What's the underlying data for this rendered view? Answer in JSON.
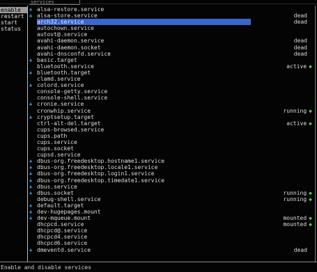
{
  "top_tab_label": "services",
  "menu": [
    {
      "label": "enable",
      "selected": true
    },
    {
      "label": "restart",
      "selected": false
    },
    {
      "label": "start",
      "selected": false
    },
    {
      "label": "status",
      "selected": false
    }
  ],
  "services": [
    {
      "name": "alsa-restore.service",
      "marker": true,
      "status": "",
      "selected": false
    },
    {
      "name": "alsa-store.service",
      "marker": true,
      "status": "dead",
      "selected": false
    },
    {
      "name": "arch32.service",
      "marker": false,
      "status": "dead",
      "selected": true
    },
    {
      "name": "autochown.service",
      "marker": false,
      "status": "",
      "selected": false
    },
    {
      "name": "autovt@.service",
      "marker": false,
      "status": "",
      "selected": false
    },
    {
      "name": "avahi-daemon.service",
      "marker": false,
      "status": "dead",
      "selected": false
    },
    {
      "name": "avahi-daemon.socket",
      "marker": false,
      "status": "dead",
      "selected": false
    },
    {
      "name": "avahi-dnsconfd.service",
      "marker": false,
      "status": "dead",
      "selected": false
    },
    {
      "name": "basic.target",
      "marker": true,
      "status": "",
      "selected": false
    },
    {
      "name": "bluetooth.service",
      "marker": false,
      "status": "active",
      "selected": false
    },
    {
      "name": "bluetooth.target",
      "marker": true,
      "status": "",
      "selected": false
    },
    {
      "name": "clamd.service",
      "marker": false,
      "status": "",
      "selected": false
    },
    {
      "name": "colord.service",
      "marker": true,
      "status": "",
      "selected": false
    },
    {
      "name": "console-getty.service",
      "marker": false,
      "status": "",
      "selected": false
    },
    {
      "name": "console-shell.service",
      "marker": false,
      "status": "",
      "selected": false
    },
    {
      "name": "cronie.service",
      "marker": true,
      "status": "",
      "selected": false
    },
    {
      "name": "cronwhip.service",
      "marker": false,
      "status": "running",
      "selected": false
    },
    {
      "name": "cryptsetup.target",
      "marker": true,
      "status": "",
      "selected": false
    },
    {
      "name": "ctrl-alt-del.target",
      "marker": false,
      "status": "active",
      "selected": false
    },
    {
      "name": "cups-browsed.service",
      "marker": false,
      "status": "",
      "selected": false
    },
    {
      "name": "cups.path",
      "marker": false,
      "status": "",
      "selected": false
    },
    {
      "name": "cups.service",
      "marker": false,
      "status": "",
      "selected": false
    },
    {
      "name": "cups.socket",
      "marker": false,
      "status": "",
      "selected": false
    },
    {
      "name": "cupsd.service",
      "marker": false,
      "status": "",
      "selected": false
    },
    {
      "name": "dbus-org.freedesktop.hostname1.service",
      "marker": true,
      "status": "",
      "selected": false
    },
    {
      "name": "dbus-org.freedesktop.locale1.service",
      "marker": true,
      "status": "",
      "selected": false
    },
    {
      "name": "dbus-org.freedesktop.login1.service",
      "marker": true,
      "status": "",
      "selected": false
    },
    {
      "name": "dbus-org.freedesktop.timedate1.service",
      "marker": true,
      "status": "",
      "selected": false
    },
    {
      "name": "dbus.service",
      "marker": true,
      "status": "",
      "selected": false
    },
    {
      "name": "dbus.socket",
      "marker": true,
      "status": "running",
      "selected": false
    },
    {
      "name": "debug-shell.service",
      "marker": false,
      "status": "running",
      "selected": false
    },
    {
      "name": "default.target",
      "marker": true,
      "status": "",
      "selected": false
    },
    {
      "name": "dev-hugepages.mount",
      "marker": true,
      "status": "",
      "selected": false
    },
    {
      "name": "dev-mqueue.mount",
      "marker": true,
      "status": "mounted",
      "selected": false
    },
    {
      "name": "dhcpcd.service",
      "marker": false,
      "status": "mounted",
      "selected": false
    },
    {
      "name": "dhcpcd@.service",
      "marker": false,
      "status": "",
      "selected": false
    },
    {
      "name": "dhcpcd4.service",
      "marker": false,
      "status": "",
      "selected": false
    },
    {
      "name": "dhcpcd6.service",
      "marker": false,
      "status": "",
      "selected": false
    },
    {
      "name": "dmeventd.service",
      "marker": true,
      "status": "dead",
      "selected": false
    }
  ],
  "footer": "Enable and disable services",
  "colors": {
    "accent": "#3a67cf",
    "marker": "#2f8fd6",
    "status_dot": "#49d14f"
  }
}
